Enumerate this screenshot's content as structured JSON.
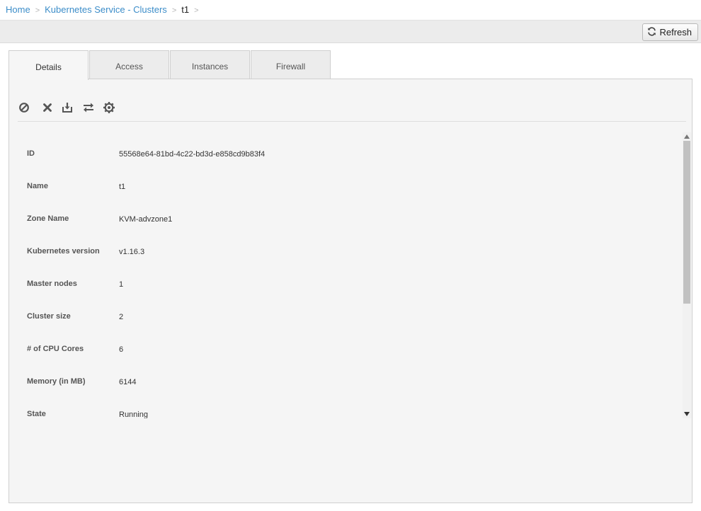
{
  "breadcrumb": {
    "items": [
      "Home",
      "Kubernetes Service - Clusters",
      "t1"
    ],
    "separator": ">"
  },
  "toolbar": {
    "refresh_label": "Refresh"
  },
  "tabs": [
    "Details",
    "Access",
    "Instances",
    "Firewall"
  ],
  "actions": [
    "stop-icon",
    "destroy-icon",
    "download-config-icon",
    "scale-icon",
    "upgrade-icon"
  ],
  "details": [
    {
      "label": "ID",
      "value": "55568e64-81bd-4c22-bd3d-e858cd9b83f4"
    },
    {
      "label": "Name",
      "value": "t1"
    },
    {
      "label": "Zone Name",
      "value": "KVM-advzone1"
    },
    {
      "label": "Kubernetes version",
      "value": "v1.16.3"
    },
    {
      "label": "Master nodes",
      "value": "1"
    },
    {
      "label": "Cluster size",
      "value": "2"
    },
    {
      "label": "# of CPU Cores",
      "value": "6"
    },
    {
      "label": "Memory (in MB)",
      "value": "6144"
    },
    {
      "label": "State",
      "value": "Running"
    }
  ],
  "colors": {
    "link": "#3c8dc9",
    "panel": "#f5f5f5",
    "toolbar": "#ececec"
  }
}
